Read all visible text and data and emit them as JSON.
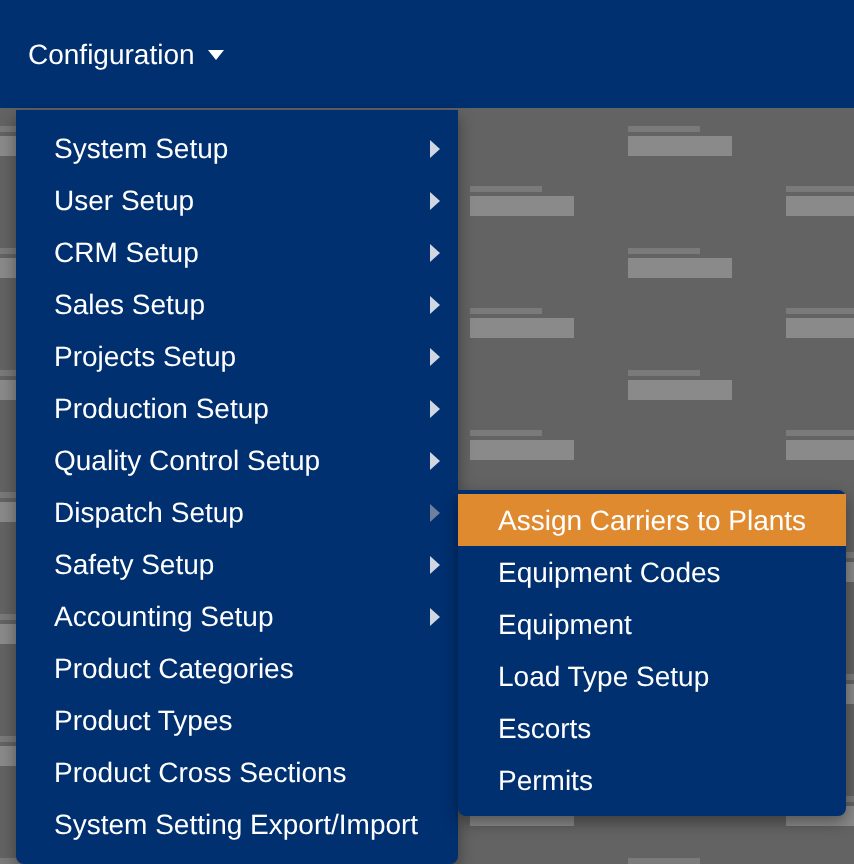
{
  "navbar": {
    "menu_label": "Configuration"
  },
  "menu": {
    "items": [
      {
        "label": "System Setup",
        "has_submenu": true,
        "open": false
      },
      {
        "label": "User Setup",
        "has_submenu": true,
        "open": false
      },
      {
        "label": "CRM Setup",
        "has_submenu": true,
        "open": false
      },
      {
        "label": "Sales Setup",
        "has_submenu": true,
        "open": false
      },
      {
        "label": "Projects Setup",
        "has_submenu": true,
        "open": false
      },
      {
        "label": "Production Setup",
        "has_submenu": true,
        "open": false
      },
      {
        "label": "Quality Control Setup",
        "has_submenu": true,
        "open": false
      },
      {
        "label": "Dispatch Setup",
        "has_submenu": true,
        "open": true
      },
      {
        "label": "Safety Setup",
        "has_submenu": true,
        "open": false
      },
      {
        "label": "Accounting Setup",
        "has_submenu": true,
        "open": false
      },
      {
        "label": "Product Categories",
        "has_submenu": false,
        "open": false
      },
      {
        "label": "Product Types",
        "has_submenu": false,
        "open": false
      },
      {
        "label": "Product Cross Sections",
        "has_submenu": false,
        "open": false
      },
      {
        "label": "System Setting Export/Import",
        "has_submenu": false,
        "open": false
      }
    ]
  },
  "submenu": {
    "items": [
      {
        "label": "Assign Carriers to Plants",
        "selected": true
      },
      {
        "label": "Equipment Codes",
        "selected": false
      },
      {
        "label": "Equipment",
        "selected": false
      },
      {
        "label": "Load Type Setup",
        "selected": false
      },
      {
        "label": "Escorts",
        "selected": false
      },
      {
        "label": "Permits",
        "selected": false
      }
    ]
  }
}
